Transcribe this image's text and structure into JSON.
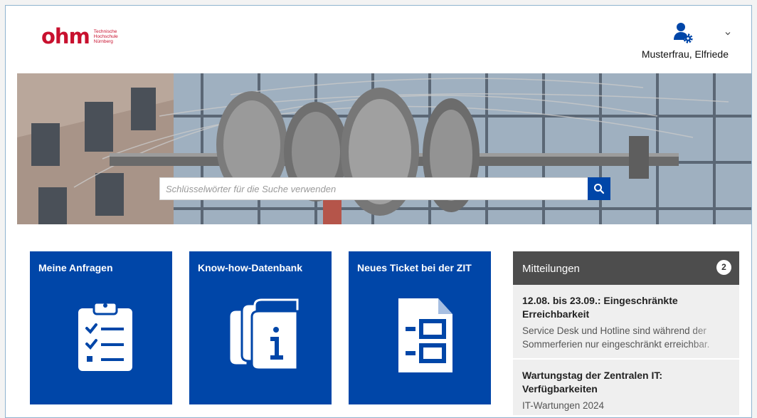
{
  "header": {
    "logo_word": "ohm",
    "logo_sub_lines": [
      "Technische",
      "Hochschule",
      "Nürnberg"
    ],
    "user_name": "Musterfrau, Elfriede",
    "user_icon": "user-gear-icon",
    "user_menu_icon": "chevron-down-icon"
  },
  "search": {
    "placeholder": "Schlüsselwörter für die Suche verwenden",
    "button_icon": "search-icon"
  },
  "tiles": [
    {
      "label": "Meine Anfragen",
      "icon": "clipboard-checklist-icon"
    },
    {
      "label": "Know-how-Datenbank",
      "icon": "books-info-icon"
    },
    {
      "label": "Neues Ticket bei der ZIT",
      "icon": "document-form-icon"
    }
  ],
  "messages": {
    "title": "Mitteilungen",
    "count": "2",
    "items": [
      {
        "title": "12.08. bis 23.09.: Eingeschränkte Erreichbarkeit",
        "body": "Service Desk und Hotline sind während der Sommerferien nur eingeschränkt erreichbar."
      },
      {
        "title": "Wartungstag der Zentralen IT: Verfügbarkeiten",
        "body": "IT-Wartungen 2024"
      }
    ]
  },
  "colors": {
    "brand_red": "#c8102e",
    "tile_blue": "#0046a8",
    "panel_dark": "#4d4d4d"
  }
}
